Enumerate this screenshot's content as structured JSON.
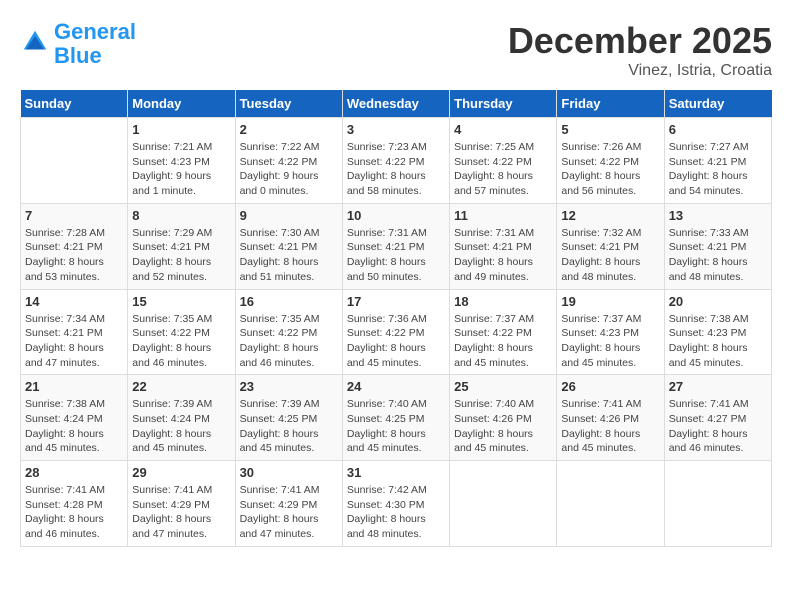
{
  "header": {
    "logo_line1": "General",
    "logo_line2": "Blue",
    "month": "December 2025",
    "location": "Vinez, Istria, Croatia"
  },
  "weekdays": [
    "Sunday",
    "Monday",
    "Tuesday",
    "Wednesday",
    "Thursday",
    "Friday",
    "Saturday"
  ],
  "weeks": [
    [
      {
        "day": "",
        "info": ""
      },
      {
        "day": "1",
        "info": "Sunrise: 7:21 AM\nSunset: 4:23 PM\nDaylight: 9 hours\nand 1 minute."
      },
      {
        "day": "2",
        "info": "Sunrise: 7:22 AM\nSunset: 4:22 PM\nDaylight: 9 hours\nand 0 minutes."
      },
      {
        "day": "3",
        "info": "Sunrise: 7:23 AM\nSunset: 4:22 PM\nDaylight: 8 hours\nand 58 minutes."
      },
      {
        "day": "4",
        "info": "Sunrise: 7:25 AM\nSunset: 4:22 PM\nDaylight: 8 hours\nand 57 minutes."
      },
      {
        "day": "5",
        "info": "Sunrise: 7:26 AM\nSunset: 4:22 PM\nDaylight: 8 hours\nand 56 minutes."
      },
      {
        "day": "6",
        "info": "Sunrise: 7:27 AM\nSunset: 4:21 PM\nDaylight: 8 hours\nand 54 minutes."
      }
    ],
    [
      {
        "day": "7",
        "info": "Sunrise: 7:28 AM\nSunset: 4:21 PM\nDaylight: 8 hours\nand 53 minutes."
      },
      {
        "day": "8",
        "info": "Sunrise: 7:29 AM\nSunset: 4:21 PM\nDaylight: 8 hours\nand 52 minutes."
      },
      {
        "day": "9",
        "info": "Sunrise: 7:30 AM\nSunset: 4:21 PM\nDaylight: 8 hours\nand 51 minutes."
      },
      {
        "day": "10",
        "info": "Sunrise: 7:31 AM\nSunset: 4:21 PM\nDaylight: 8 hours\nand 50 minutes."
      },
      {
        "day": "11",
        "info": "Sunrise: 7:31 AM\nSunset: 4:21 PM\nDaylight: 8 hours\nand 49 minutes."
      },
      {
        "day": "12",
        "info": "Sunrise: 7:32 AM\nSunset: 4:21 PM\nDaylight: 8 hours\nand 48 minutes."
      },
      {
        "day": "13",
        "info": "Sunrise: 7:33 AM\nSunset: 4:21 PM\nDaylight: 8 hours\nand 48 minutes."
      }
    ],
    [
      {
        "day": "14",
        "info": "Sunrise: 7:34 AM\nSunset: 4:21 PM\nDaylight: 8 hours\nand 47 minutes."
      },
      {
        "day": "15",
        "info": "Sunrise: 7:35 AM\nSunset: 4:22 PM\nDaylight: 8 hours\nand 46 minutes."
      },
      {
        "day": "16",
        "info": "Sunrise: 7:35 AM\nSunset: 4:22 PM\nDaylight: 8 hours\nand 46 minutes."
      },
      {
        "day": "17",
        "info": "Sunrise: 7:36 AM\nSunset: 4:22 PM\nDaylight: 8 hours\nand 45 minutes."
      },
      {
        "day": "18",
        "info": "Sunrise: 7:37 AM\nSunset: 4:22 PM\nDaylight: 8 hours\nand 45 minutes."
      },
      {
        "day": "19",
        "info": "Sunrise: 7:37 AM\nSunset: 4:23 PM\nDaylight: 8 hours\nand 45 minutes."
      },
      {
        "day": "20",
        "info": "Sunrise: 7:38 AM\nSunset: 4:23 PM\nDaylight: 8 hours\nand 45 minutes."
      }
    ],
    [
      {
        "day": "21",
        "info": "Sunrise: 7:38 AM\nSunset: 4:24 PM\nDaylight: 8 hours\nand 45 minutes."
      },
      {
        "day": "22",
        "info": "Sunrise: 7:39 AM\nSunset: 4:24 PM\nDaylight: 8 hours\nand 45 minutes."
      },
      {
        "day": "23",
        "info": "Sunrise: 7:39 AM\nSunset: 4:25 PM\nDaylight: 8 hours\nand 45 minutes."
      },
      {
        "day": "24",
        "info": "Sunrise: 7:40 AM\nSunset: 4:25 PM\nDaylight: 8 hours\nand 45 minutes."
      },
      {
        "day": "25",
        "info": "Sunrise: 7:40 AM\nSunset: 4:26 PM\nDaylight: 8 hours\nand 45 minutes."
      },
      {
        "day": "26",
        "info": "Sunrise: 7:41 AM\nSunset: 4:26 PM\nDaylight: 8 hours\nand 45 minutes."
      },
      {
        "day": "27",
        "info": "Sunrise: 7:41 AM\nSunset: 4:27 PM\nDaylight: 8 hours\nand 46 minutes."
      }
    ],
    [
      {
        "day": "28",
        "info": "Sunrise: 7:41 AM\nSunset: 4:28 PM\nDaylight: 8 hours\nand 46 minutes."
      },
      {
        "day": "29",
        "info": "Sunrise: 7:41 AM\nSunset: 4:29 PM\nDaylight: 8 hours\nand 47 minutes."
      },
      {
        "day": "30",
        "info": "Sunrise: 7:41 AM\nSunset: 4:29 PM\nDaylight: 8 hours\nand 47 minutes."
      },
      {
        "day": "31",
        "info": "Sunrise: 7:42 AM\nSunset: 4:30 PM\nDaylight: 8 hours\nand 48 minutes."
      },
      {
        "day": "",
        "info": ""
      },
      {
        "day": "",
        "info": ""
      },
      {
        "day": "",
        "info": ""
      }
    ]
  ]
}
